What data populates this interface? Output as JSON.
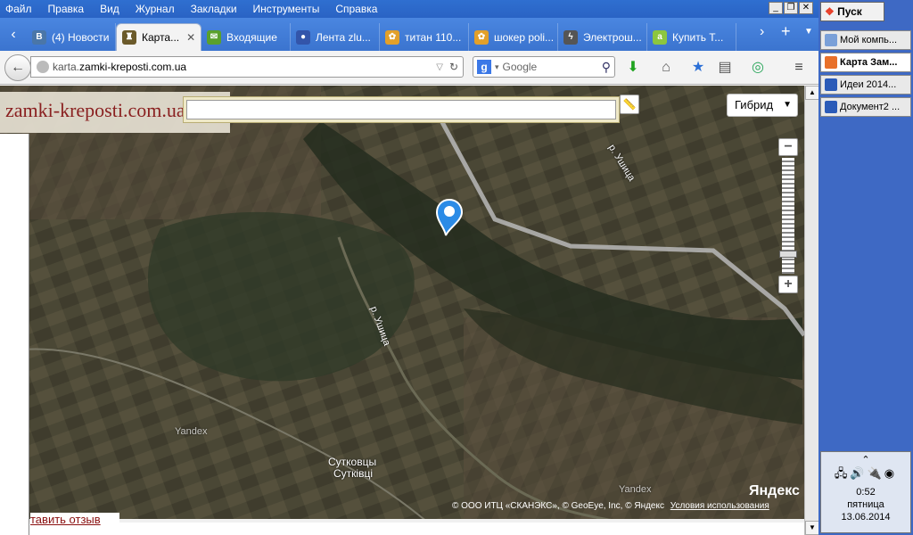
{
  "menubar": {
    "items": [
      "Файл",
      "Правка",
      "Вид",
      "Журнал",
      "Закладки",
      "Инструменты",
      "Справка"
    ]
  },
  "tabs": [
    {
      "label": "(4) Новости",
      "icon": "vk-icon",
      "color": "#4a76a8",
      "glyph": "В"
    },
    {
      "label": "Карта...",
      "icon": "castle-icon",
      "color": "#6b5a2a",
      "glyph": "♜",
      "active": true
    },
    {
      "label": "Входящие",
      "icon": "mail-icon",
      "color": "#5aa02c",
      "glyph": "✉"
    },
    {
      "label": "Лента zlu...",
      "icon": "user-icon",
      "color": "#3355aa",
      "glyph": "●"
    },
    {
      "label": "титан 110...",
      "icon": "leaf-icon",
      "color": "#e2a02a",
      "glyph": "✿"
    },
    {
      "label": "шокер poli...",
      "icon": "leaf-icon",
      "color": "#e2a02a",
      "glyph": "✿"
    },
    {
      "label": "Электрош...",
      "icon": "bolt-icon",
      "color": "#555555",
      "glyph": "ϟ"
    },
    {
      "label": "Купить Т...",
      "icon": "abo-icon",
      "color": "#8cc63f",
      "glyph": "a"
    }
  ],
  "address": {
    "prefix": "karta.",
    "domain": "zamki-kreposti.com.ua"
  },
  "search": {
    "engine": "Google",
    "placeholder": "Google"
  },
  "map": {
    "site_title": "zamki-kreposti.com.ua",
    "map_type": "Гибрид",
    "labels": [
      {
        "text": "р. Ушица",
        "name": "river-label-north"
      },
      {
        "text": "р. Ушица",
        "name": "river-label-center"
      },
      {
        "text": "Yandex",
        "name": "watermark-left"
      },
      {
        "text": "Yandex",
        "name": "watermark-right"
      },
      {
        "text": "Сутковцы",
        "name": "village-label-ru"
      },
      {
        "text": "Сутківці",
        "name": "village-label-ua"
      }
    ],
    "copyright": "© ООО ИТЦ «СКАНЭКС», © GeoEye, Inc, © Яндекс",
    "terms": "Условия использования",
    "logo": "Яндекс",
    "feedback": "тавить отзыв"
  },
  "taskbar": {
    "start": "Пуск",
    "items": [
      {
        "label": "Мой компь...",
        "icon": "computer-icon"
      },
      {
        "label": "Карта Зам...",
        "icon": "firefox-icon",
        "active": true
      },
      {
        "label": "Идеи 2014...",
        "icon": "word-icon"
      },
      {
        "label": "Документ2 ...",
        "icon": "word-icon"
      }
    ],
    "time": "0:52",
    "weekday": "пятница",
    "date": "13.06.2014"
  }
}
